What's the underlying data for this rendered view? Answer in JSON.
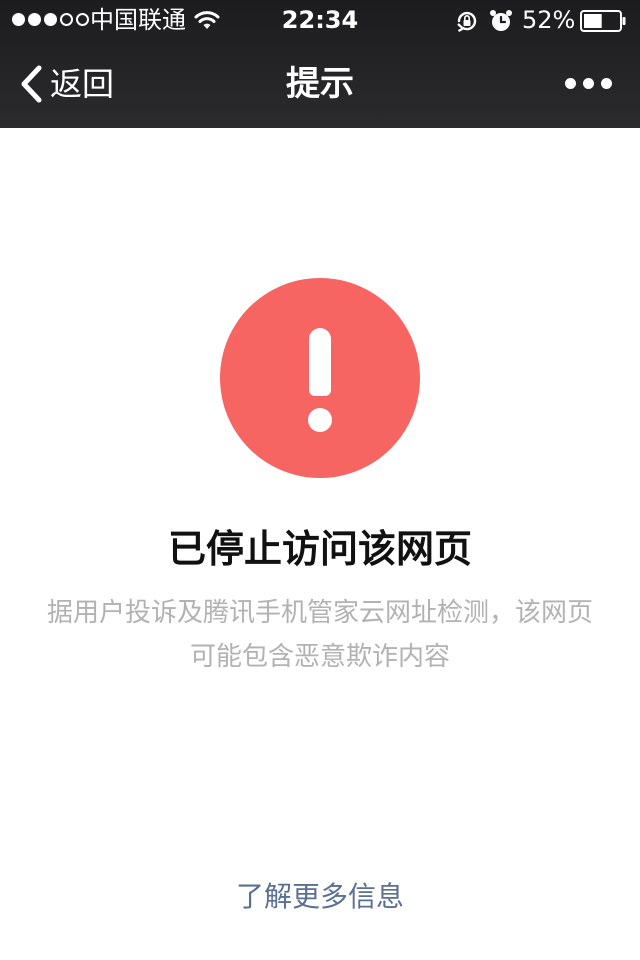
{
  "status_bar": {
    "signal_dots": {
      "filled": 3,
      "total": 5
    },
    "carrier": "中国联通",
    "time": "22:34",
    "battery_percent": "52%",
    "battery_level": 0.52,
    "icons": [
      "wifi-icon",
      "orientation-lock-icon",
      "alarm-icon",
      "battery-icon"
    ]
  },
  "nav": {
    "back_label": "返回",
    "title": "提示",
    "more_icon": "ellipsis-icon"
  },
  "main": {
    "warning_icon": "exclamation-icon",
    "warning_color": "#f76563",
    "title": "已停止访问该网页",
    "description_line1": "据用户投诉及腾讯手机管家云网址检测，该网页",
    "description_line2": "可能包含恶意欺诈内容",
    "more_info_link": "了解更多信息"
  },
  "colors": {
    "nav_background": "#1c1c1e",
    "link": "#5b6f95",
    "description": "#b2b2b2"
  }
}
